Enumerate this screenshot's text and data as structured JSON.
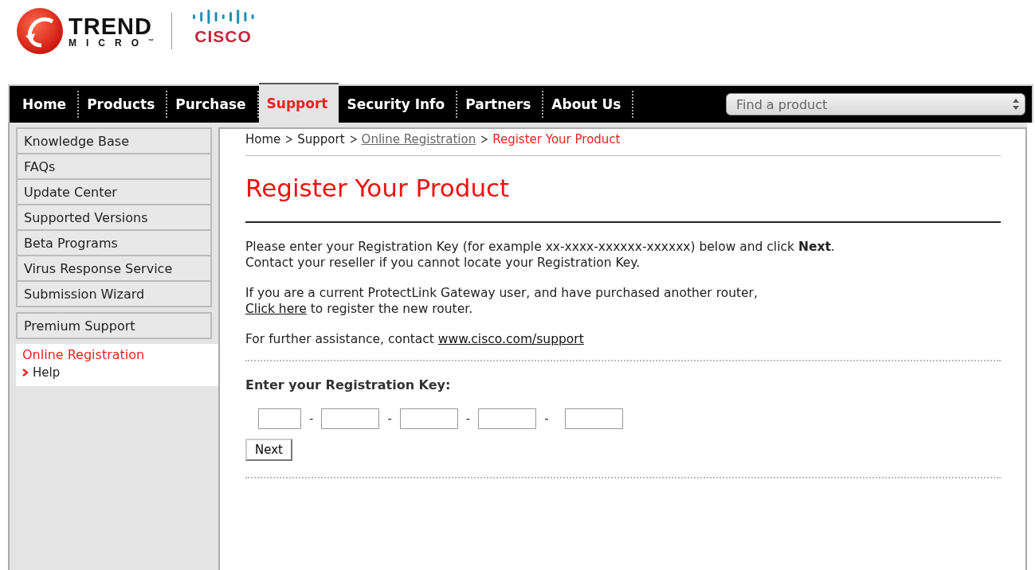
{
  "logos": {
    "trend_name": "TREND",
    "trend_sub": "MICRO",
    "trend_mark": "™",
    "cisco": "CISCO"
  },
  "nav": {
    "tabs": [
      {
        "label": "Home",
        "selected": false
      },
      {
        "label": "Products",
        "selected": false
      },
      {
        "label": "Purchase",
        "selected": false
      },
      {
        "label": "Support",
        "selected": true
      },
      {
        "label": "Security Info",
        "selected": false
      },
      {
        "label": "Partners",
        "selected": false
      },
      {
        "label": "About Us",
        "selected": false
      }
    ],
    "search": {
      "placeholder": "Find a product"
    }
  },
  "sidebar": {
    "groups": [
      [
        {
          "label": "Knowledge Base"
        },
        {
          "label": "FAQs"
        },
        {
          "label": "Update Center"
        },
        {
          "label": "Supported Versions"
        },
        {
          "label": "Beta Programs"
        },
        {
          "label": "Virus Response Service"
        },
        {
          "label": "Submission Wizard"
        }
      ],
      [
        {
          "label": "Premium Support"
        }
      ]
    ],
    "current": {
      "label": "Online Registration",
      "children": [
        {
          "label": "Help"
        }
      ]
    }
  },
  "breadcrumb": [
    {
      "label": "Home",
      "kind": "text"
    },
    {
      "label": "Support",
      "kind": "text"
    },
    {
      "label": "Online Registration",
      "kind": "link"
    },
    {
      "label": "Register Your Product",
      "kind": "current"
    }
  ],
  "title": "Register Your Product",
  "paragraphs": [
    {
      "lines": [
        [
          {
            "kind": "text",
            "text": "Please enter your Registration Key (for example xx-xxxx-xxxxxx-xxxxxx) below and click **Next**."
          }
        ],
        [
          {
            "kind": "text",
            "text": "Contact your reseller if you cannot locate your Registration Key."
          }
        ]
      ]
    },
    {
      "lines": [
        [
          {
            "kind": "text",
            "text": "If you are a current ProtectLink Gateway user, and have purchased another router,"
          }
        ],
        [
          {
            "kind": "link",
            "text": "Click here"
          },
          {
            "kind": "text",
            "text": " to register the new router."
          }
        ]
      ]
    },
    {
      "lines": [
        [
          {
            "kind": "text",
            "text": "For further assistance, contact "
          },
          {
            "kind": "link",
            "text": "www.cisco.com/support"
          }
        ]
      ]
    }
  ],
  "key_form": {
    "label": "Enter your Registration Key:",
    "separators": [
      "-",
      "-",
      "-",
      "-"
    ],
    "button": "Next"
  }
}
